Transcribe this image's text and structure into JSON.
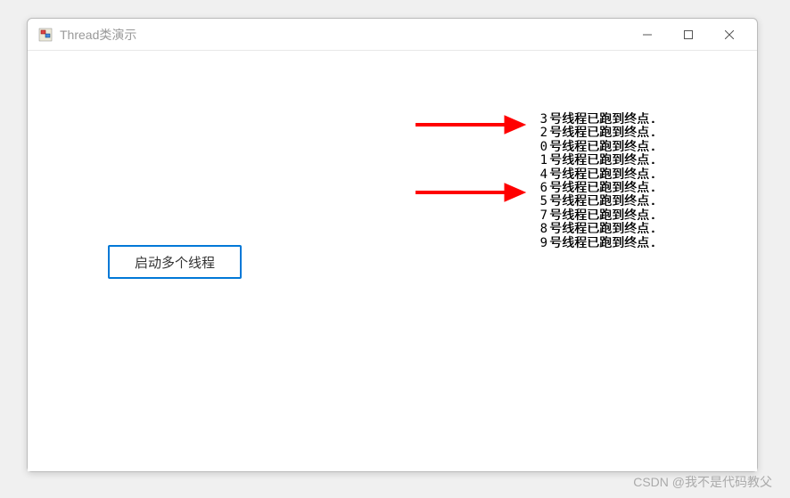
{
  "window": {
    "title": "Thread类演示"
  },
  "button": {
    "start_label": "启动多个线程"
  },
  "threads": [
    {
      "num": "3",
      "text": "号线程已跑到终点."
    },
    {
      "num": "2",
      "text": "号线程已跑到终点."
    },
    {
      "num": "0",
      "text": "号线程已跑到终点."
    },
    {
      "num": "1",
      "text": "号线程已跑到终点."
    },
    {
      "num": "4",
      "text": "号线程已跑到终点."
    },
    {
      "num": "6",
      "text": "号线程已跑到终点."
    },
    {
      "num": "5",
      "text": "号线程已跑到终点."
    },
    {
      "num": "7",
      "text": "号线程已跑到终点."
    },
    {
      "num": "8",
      "text": "号线程已跑到终点."
    },
    {
      "num": "9",
      "text": "号线程已跑到终点."
    }
  ],
  "watermark": "CSDN @我不是代码教父"
}
